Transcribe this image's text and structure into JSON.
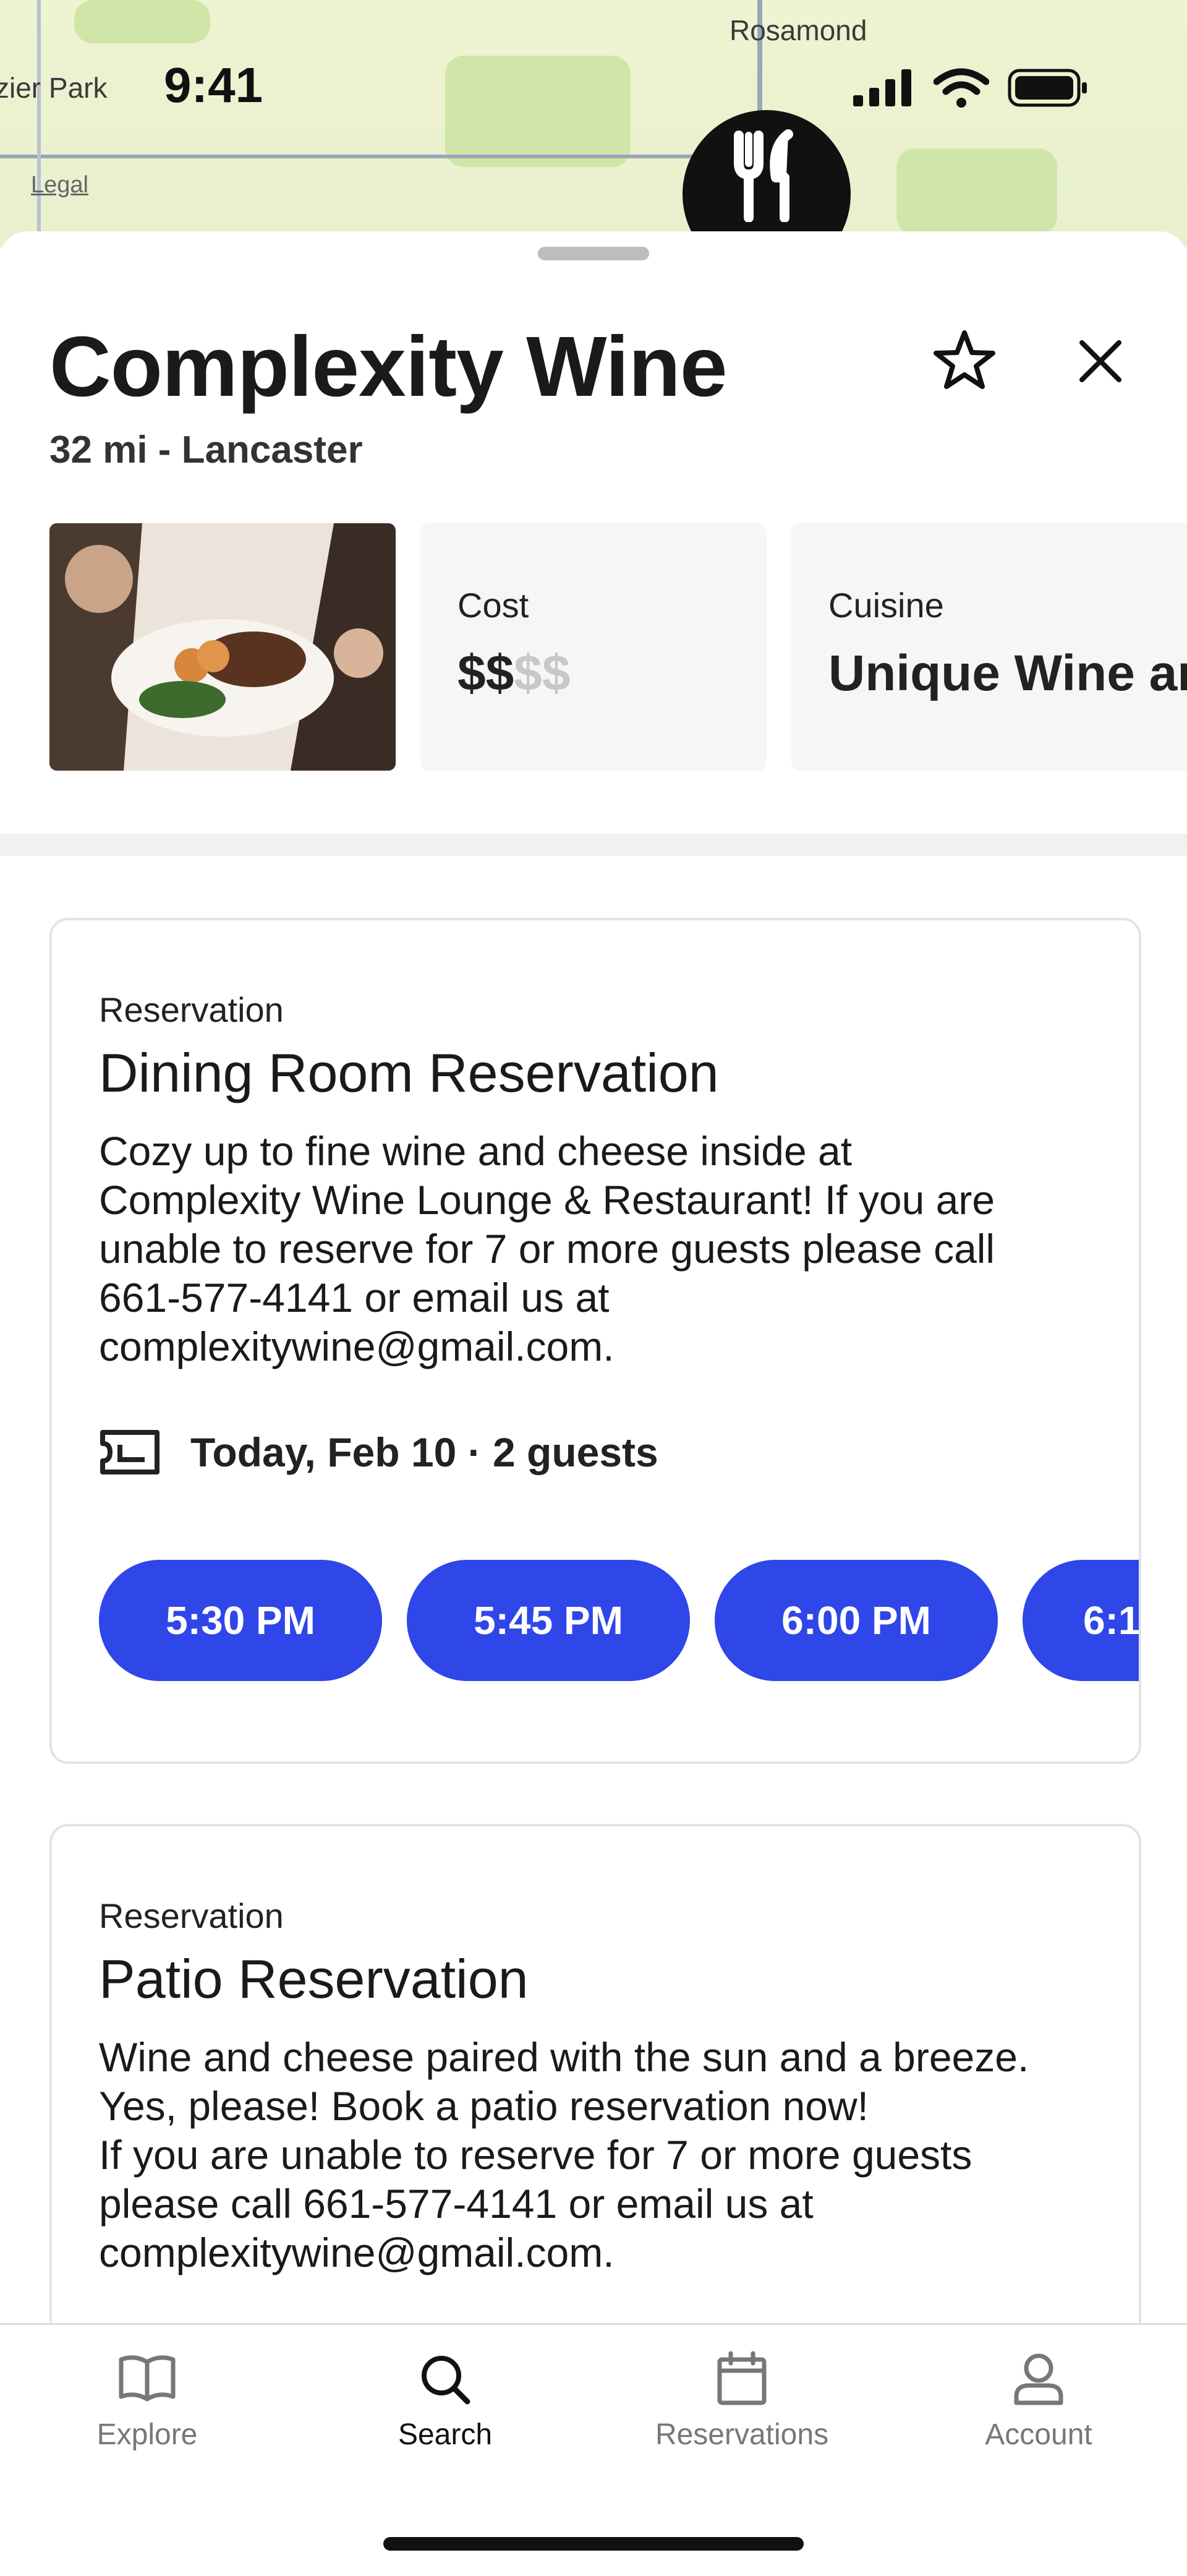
{
  "status_bar": {
    "time": "9:41"
  },
  "map": {
    "labels": [
      "Rosamond",
      "zier Park"
    ],
    "legal": "Legal",
    "pin_icon": "fork-knife-icon"
  },
  "restaurant": {
    "name": "Complexity Wine",
    "distance_location": "32 mi - Lancaster",
    "favorite_icon": "star-outline-icon",
    "close_icon": "close-icon",
    "cost": {
      "label": "Cost",
      "level": 2,
      "active": "$$",
      "inactive": "$$"
    },
    "cuisine": {
      "label": "Cuisine",
      "value": "Unique Wine an"
    }
  },
  "reservations": [
    {
      "kind": "Reservation",
      "name": "Dining Room Reservation",
      "description": "Cozy up to fine wine and cheese inside at\nComplexity Wine Lounge & Restaurant! If you are\nunable to reserve for 7 or more guests please call\n661-577-4141 or email us at\ncomplexitywine@gmail.com.",
      "when": "Today, Feb 10 · 2 guests",
      "slots": [
        "5:30 PM",
        "5:45 PM",
        "6:00 PM",
        "6:1"
      ]
    },
    {
      "kind": "Reservation",
      "name": "Patio Reservation",
      "description": "Wine and cheese paired with the sun and a breeze.\nYes, please! Book a patio reservation now!\nIf you are unable to reserve for 7 or more guests\nplease call 661-577-4141 or email us at\ncomplexitywine@gmail.com."
    }
  ],
  "tabbar": {
    "active": "Search",
    "items": [
      {
        "label": "Explore",
        "icon": "book-icon"
      },
      {
        "label": "Search",
        "icon": "search-icon"
      },
      {
        "label": "Reservations",
        "icon": "calendar-icon"
      },
      {
        "label": "Account",
        "icon": "person-icon"
      }
    ]
  },
  "colors": {
    "accent": "#2f46e8",
    "map_base": "#eef3d2",
    "map_green": "#cfe6a8"
  }
}
